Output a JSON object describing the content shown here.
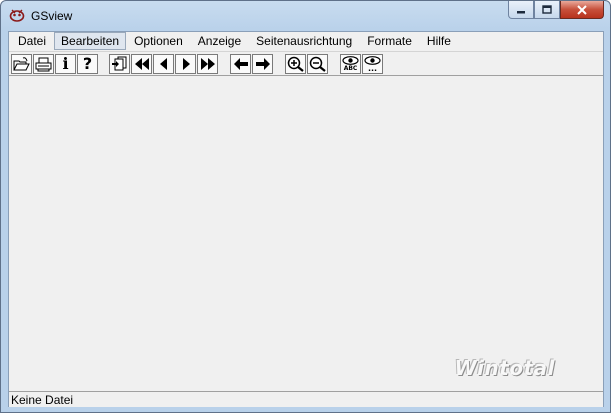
{
  "window": {
    "title": "GSview"
  },
  "menu": {
    "items": [
      {
        "label": "Datei"
      },
      {
        "label": "Bearbeiten",
        "active": true
      },
      {
        "label": "Optionen"
      },
      {
        "label": "Anzeige"
      },
      {
        "label": "Seitenausrichtung"
      },
      {
        "label": "Formate"
      },
      {
        "label": "Hilfe"
      }
    ]
  },
  "toolbar": {
    "buttons": [
      {
        "icon": "open-folder-icon"
      },
      {
        "icon": "print-icon"
      },
      {
        "icon": "info-icon",
        "glyph": "i"
      },
      {
        "icon": "help-icon",
        "glyph": "?"
      },
      {
        "icon": "goto-page-icon"
      },
      {
        "icon": "first-page-icon"
      },
      {
        "icon": "previous-page-icon"
      },
      {
        "icon": "next-page-icon"
      },
      {
        "icon": "last-page-icon"
      },
      {
        "icon": "back-arrow-icon"
      },
      {
        "icon": "forward-arrow-icon"
      },
      {
        "icon": "zoom-in-icon"
      },
      {
        "icon": "zoom-out-icon"
      },
      {
        "icon": "find-text-icon",
        "glyph": "ABC"
      },
      {
        "icon": "find-next-icon",
        "glyph": "..."
      }
    ]
  },
  "watermark": {
    "text": "Wintotal"
  },
  "status": {
    "text": "Keine Datei"
  },
  "colors": {
    "frame": "#b9d1ea",
    "client": "#f0f0f0",
    "close_button": "#c7503b"
  }
}
